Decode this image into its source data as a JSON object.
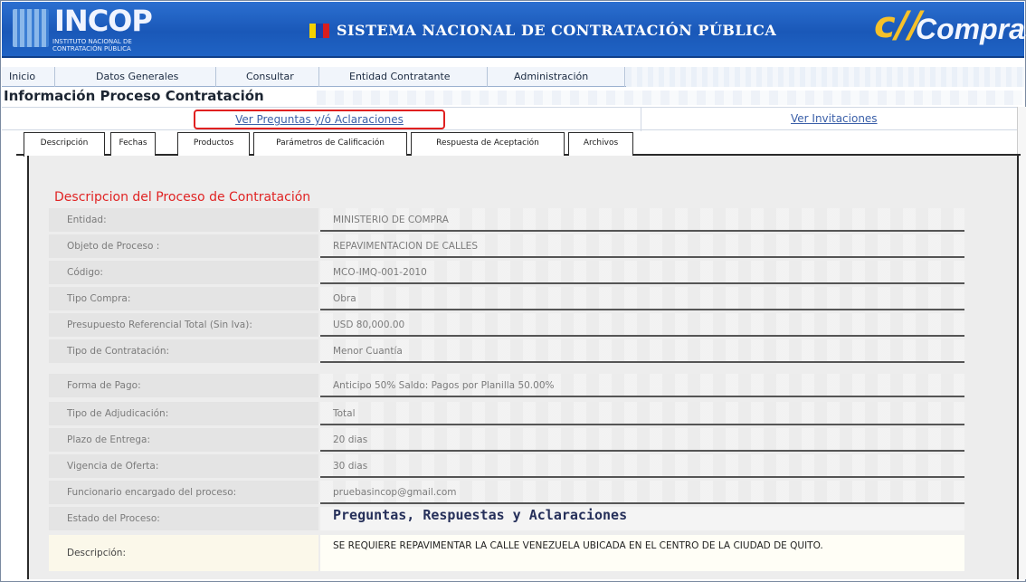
{
  "header": {
    "incop_title": "INCOP",
    "incop_subtitle": "INSTITUTO NACIONAL DE CONTRATACIÓN PÚBLICA",
    "system_title": "SISTEMA NACIONAL DE CONTRATACIÓN PÚBLICA",
    "compras_label": "Compras",
    "compras_mark": "c//",
    "flag_colors": [
      "#f5d000",
      "#1a3fa8",
      "#d81e1e"
    ]
  },
  "menu": {
    "items": [
      "Inicio",
      "Datos Generales",
      "Consultar",
      "Entidad Contratante",
      "Administración"
    ]
  },
  "page_title": "Información Proceso Contratación",
  "links": {
    "preguntas": "Ver Preguntas y/ó Aclaraciones",
    "invitaciones": "Ver Invitaciones"
  },
  "tabs": [
    "Descripción",
    "Fechas",
    "Productos",
    "Parámetros de Calificación",
    "Respuesta de Aceptación",
    "Archivos"
  ],
  "section_title": "Descripcion del Proceso de Contratación",
  "fields": [
    {
      "label": "Entidad:",
      "value": "MINISTERIO DE COMPRA"
    },
    {
      "label": "Objeto de Proceso :",
      "value": "REPAVIMENTACION DE CALLES"
    },
    {
      "label": "Código:",
      "value": "MCO-IMQ-001-2010"
    },
    {
      "label": "Tipo Compra:",
      "value": "Obra"
    },
    {
      "label": "Presupuesto Referencial Total (Sin Iva):",
      "value": "USD 80,000.00"
    },
    {
      "label": "Tipo de Contratación:",
      "value": "Menor Cuantía"
    },
    {
      "label": "Forma de Pago:",
      "value": "Anticipo 50% Saldo: Pagos por Planilla 50.00%"
    },
    {
      "label": "Tipo de Adjudicación:",
      "value": "Total"
    },
    {
      "label": "Plazo de Entrega:",
      "value": "20 dias"
    },
    {
      "label": "Vigencia de Oferta:",
      "value": "30 dias"
    },
    {
      "label": "Funcionario encargado del proceso:",
      "value": "pruebasincop@gmail.com"
    },
    {
      "label": "Estado del Proceso:",
      "value": "Preguntas, Respuestas y Aclaraciones"
    }
  ],
  "description": {
    "label": "Descripción:",
    "value": "SE REQUIERE REPAVIMENTAR LA CALLE VENEZUELA UBICADA EN EL CENTRO DE LA CIUDAD DE QUITO."
  },
  "colors": {
    "header_blue": "#1a58b8",
    "link_blue": "#3a5fa8",
    "highlight_red": "#e02020",
    "section_red": "#e02424"
  }
}
